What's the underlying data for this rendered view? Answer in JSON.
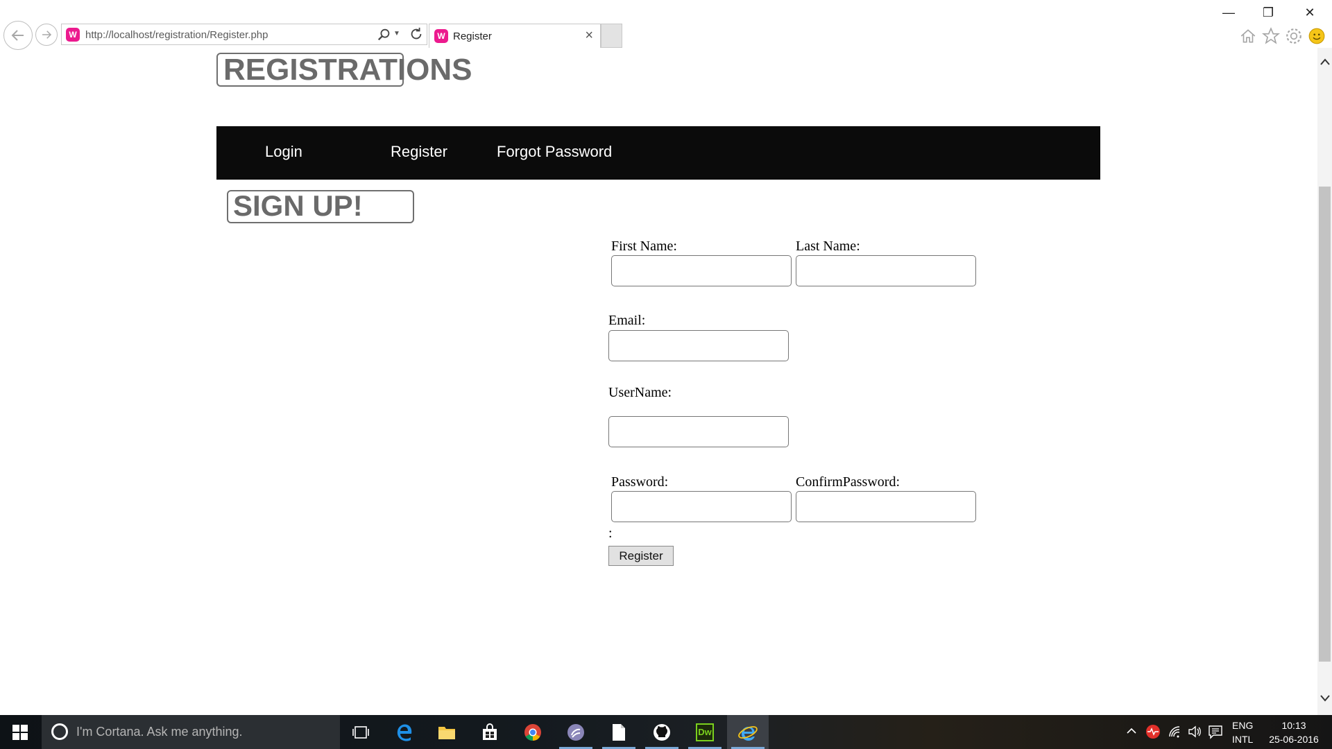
{
  "browser": {
    "url": "http://localhost/registration/Register.php",
    "tab_title": "Register",
    "site_icon_letter": "W",
    "tab_close": "×",
    "window_min": "—",
    "window_restore": "❐",
    "window_close": "✕"
  },
  "page": {
    "site_title": "REGISTRATIONS",
    "nav": {
      "login": "Login",
      "register": "Register",
      "forgot": "Forgot Password"
    },
    "signup_title": "SIGN UP!",
    "form": {
      "first_name_label": "First Name:",
      "last_name_label": "Last Name:",
      "email_label": "Email:",
      "username_label": "UserName:",
      "password_label": "Password:",
      "confirm_label": "ConfirmPassword:",
      "first_name_value": "",
      "last_name_value": "",
      "email_value": "",
      "username_value": "",
      "password_value": "",
      "confirm_value": "",
      "colon_text": ":",
      "submit_label": "Register"
    }
  },
  "taskbar": {
    "cortana_placeholder": "I'm Cortana. Ask me anything.",
    "apps": [
      "task-view-icon",
      "edge-icon",
      "file-explorer-icon",
      "store-icon",
      "chrome-icon",
      "torrent-icon",
      "notepad-icon",
      "github-icon",
      "dreamweaver-icon",
      "internet-explorer-icon"
    ],
    "dreamweaver_label": "Dw",
    "lang_top": "ENG",
    "lang_bottom": "INTL",
    "time": "10:13",
    "date": "25-06-2016"
  },
  "colors": {
    "navbar_bg": "#0b0b0b",
    "title_gray": "#6a6a6a",
    "site_icon_pink": "#ec1a8e",
    "taskbar_bg": "#141a1f"
  }
}
